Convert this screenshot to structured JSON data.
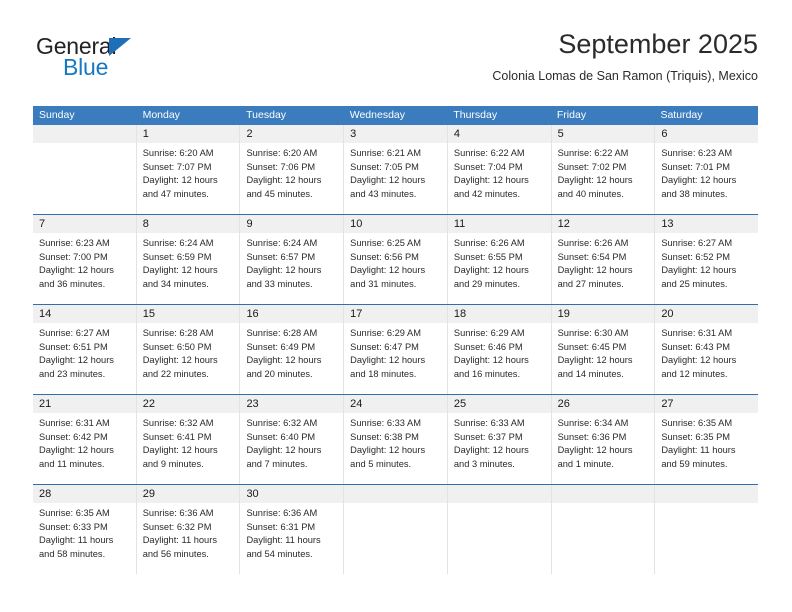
{
  "brand": {
    "name_top": "General",
    "name_bottom": "Blue",
    "accent_color": "#1778c4",
    "triangle_color": "#1f6fb8",
    "triangle_icon": "triangle-icon"
  },
  "header": {
    "title": "September 2025",
    "subtitle": "Colonia Lomas de San Ramon (Triquis), Mexico"
  },
  "theme": {
    "header_bar_color": "#3a7cbe",
    "week_divider_color": "#2f6fae",
    "date_strip_color": "#f0f0f0",
    "column_divider_color": "#e3e3e3"
  },
  "weekdays": [
    "Sunday",
    "Monday",
    "Tuesday",
    "Wednesday",
    "Thursday",
    "Friday",
    "Saturday"
  ],
  "weeks": [
    {
      "days": [
        {
          "num": "",
          "lines": []
        },
        {
          "num": "1",
          "lines": [
            "Sunrise: 6:20 AM",
            "Sunset: 7:07 PM",
            "Daylight: 12 hours",
            "and 47 minutes."
          ]
        },
        {
          "num": "2",
          "lines": [
            "Sunrise: 6:20 AM",
            "Sunset: 7:06 PM",
            "Daylight: 12 hours",
            "and 45 minutes."
          ]
        },
        {
          "num": "3",
          "lines": [
            "Sunrise: 6:21 AM",
            "Sunset: 7:05 PM",
            "Daylight: 12 hours",
            "and 43 minutes."
          ]
        },
        {
          "num": "4",
          "lines": [
            "Sunrise: 6:22 AM",
            "Sunset: 7:04 PM",
            "Daylight: 12 hours",
            "and 42 minutes."
          ]
        },
        {
          "num": "5",
          "lines": [
            "Sunrise: 6:22 AM",
            "Sunset: 7:02 PM",
            "Daylight: 12 hours",
            "and 40 minutes."
          ]
        },
        {
          "num": "6",
          "lines": [
            "Sunrise: 6:23 AM",
            "Sunset: 7:01 PM",
            "Daylight: 12 hours",
            "and 38 minutes."
          ]
        }
      ]
    },
    {
      "days": [
        {
          "num": "7",
          "lines": [
            "Sunrise: 6:23 AM",
            "Sunset: 7:00 PM",
            "Daylight: 12 hours",
            "and 36 minutes."
          ]
        },
        {
          "num": "8",
          "lines": [
            "Sunrise: 6:24 AM",
            "Sunset: 6:59 PM",
            "Daylight: 12 hours",
            "and 34 minutes."
          ]
        },
        {
          "num": "9",
          "lines": [
            "Sunrise: 6:24 AM",
            "Sunset: 6:57 PM",
            "Daylight: 12 hours",
            "and 33 minutes."
          ]
        },
        {
          "num": "10",
          "lines": [
            "Sunrise: 6:25 AM",
            "Sunset: 6:56 PM",
            "Daylight: 12 hours",
            "and 31 minutes."
          ]
        },
        {
          "num": "11",
          "lines": [
            "Sunrise: 6:26 AM",
            "Sunset: 6:55 PM",
            "Daylight: 12 hours",
            "and 29 minutes."
          ]
        },
        {
          "num": "12",
          "lines": [
            "Sunrise: 6:26 AM",
            "Sunset: 6:54 PM",
            "Daylight: 12 hours",
            "and 27 minutes."
          ]
        },
        {
          "num": "13",
          "lines": [
            "Sunrise: 6:27 AM",
            "Sunset: 6:52 PM",
            "Daylight: 12 hours",
            "and 25 minutes."
          ]
        }
      ]
    },
    {
      "days": [
        {
          "num": "14",
          "lines": [
            "Sunrise: 6:27 AM",
            "Sunset: 6:51 PM",
            "Daylight: 12 hours",
            "and 23 minutes."
          ]
        },
        {
          "num": "15",
          "lines": [
            "Sunrise: 6:28 AM",
            "Sunset: 6:50 PM",
            "Daylight: 12 hours",
            "and 22 minutes."
          ]
        },
        {
          "num": "16",
          "lines": [
            "Sunrise: 6:28 AM",
            "Sunset: 6:49 PM",
            "Daylight: 12 hours",
            "and 20 minutes."
          ]
        },
        {
          "num": "17",
          "lines": [
            "Sunrise: 6:29 AM",
            "Sunset: 6:47 PM",
            "Daylight: 12 hours",
            "and 18 minutes."
          ]
        },
        {
          "num": "18",
          "lines": [
            "Sunrise: 6:29 AM",
            "Sunset: 6:46 PM",
            "Daylight: 12 hours",
            "and 16 minutes."
          ]
        },
        {
          "num": "19",
          "lines": [
            "Sunrise: 6:30 AM",
            "Sunset: 6:45 PM",
            "Daylight: 12 hours",
            "and 14 minutes."
          ]
        },
        {
          "num": "20",
          "lines": [
            "Sunrise: 6:31 AM",
            "Sunset: 6:43 PM",
            "Daylight: 12 hours",
            "and 12 minutes."
          ]
        }
      ]
    },
    {
      "days": [
        {
          "num": "21",
          "lines": [
            "Sunrise: 6:31 AM",
            "Sunset: 6:42 PM",
            "Daylight: 12 hours",
            "and 11 minutes."
          ]
        },
        {
          "num": "22",
          "lines": [
            "Sunrise: 6:32 AM",
            "Sunset: 6:41 PM",
            "Daylight: 12 hours",
            "and 9 minutes."
          ]
        },
        {
          "num": "23",
          "lines": [
            "Sunrise: 6:32 AM",
            "Sunset: 6:40 PM",
            "Daylight: 12 hours",
            "and 7 minutes."
          ]
        },
        {
          "num": "24",
          "lines": [
            "Sunrise: 6:33 AM",
            "Sunset: 6:38 PM",
            "Daylight: 12 hours",
            "and 5 minutes."
          ]
        },
        {
          "num": "25",
          "lines": [
            "Sunrise: 6:33 AM",
            "Sunset: 6:37 PM",
            "Daylight: 12 hours",
            "and 3 minutes."
          ]
        },
        {
          "num": "26",
          "lines": [
            "Sunrise: 6:34 AM",
            "Sunset: 6:36 PM",
            "Daylight: 12 hours",
            "and 1 minute."
          ]
        },
        {
          "num": "27",
          "lines": [
            "Sunrise: 6:35 AM",
            "Sunset: 6:35 PM",
            "Daylight: 11 hours",
            "and 59 minutes."
          ]
        }
      ]
    },
    {
      "days": [
        {
          "num": "28",
          "lines": [
            "Sunrise: 6:35 AM",
            "Sunset: 6:33 PM",
            "Daylight: 11 hours",
            "and 58 minutes."
          ]
        },
        {
          "num": "29",
          "lines": [
            "Sunrise: 6:36 AM",
            "Sunset: 6:32 PM",
            "Daylight: 11 hours",
            "and 56 minutes."
          ]
        },
        {
          "num": "30",
          "lines": [
            "Sunrise: 6:36 AM",
            "Sunset: 6:31 PM",
            "Daylight: 11 hours",
            "and 54 minutes."
          ]
        },
        {
          "num": "",
          "lines": []
        },
        {
          "num": "",
          "lines": []
        },
        {
          "num": "",
          "lines": []
        },
        {
          "num": "",
          "lines": []
        }
      ]
    }
  ]
}
